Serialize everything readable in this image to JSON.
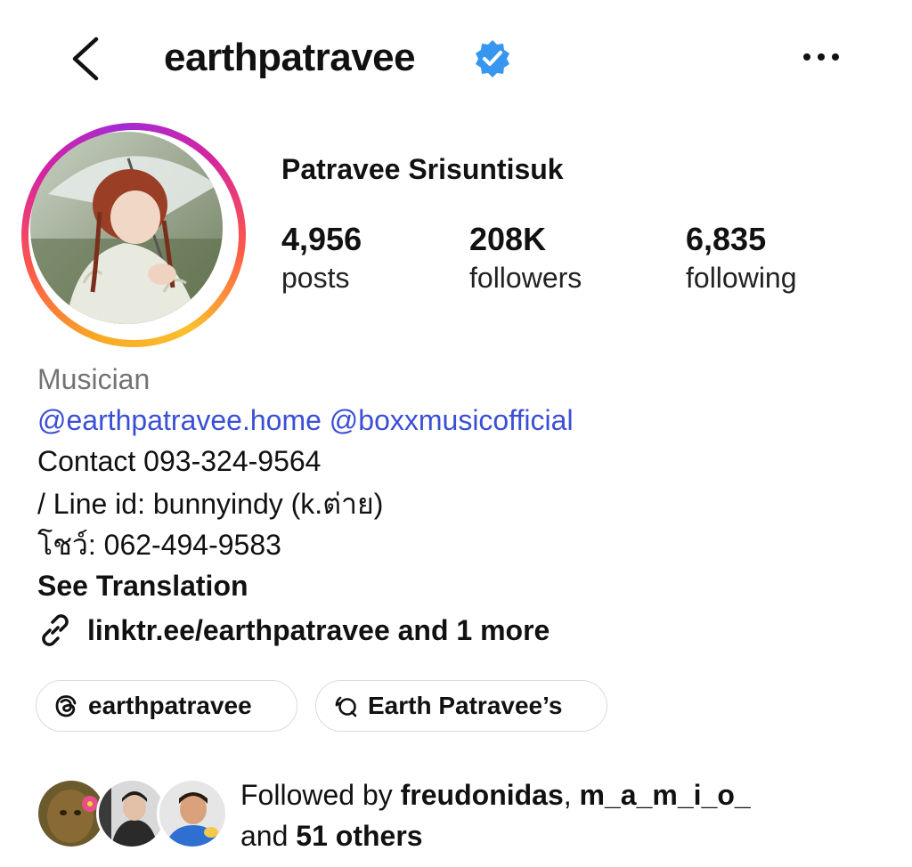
{
  "header": {
    "username": "earthpatravee",
    "back_icon": "chevron-left-icon",
    "verified_icon": "verified-badge-icon",
    "more_icon": "more-horizontal-icon"
  },
  "profile": {
    "full_name": "Patravee Srisuntisuk",
    "stats": {
      "posts": {
        "value": "4,956",
        "label": "posts"
      },
      "followers": {
        "value": "208K",
        "label": "followers"
      },
      "following": {
        "value": "6,835",
        "label": "following"
      }
    }
  },
  "bio": {
    "category": "Musician",
    "mentions": [
      "@earthpatravee.home",
      "@boxxmusicofficial"
    ],
    "lines": [
      "Contact 093-324-9564",
      "/ Line id: bunnyindy (k.ต่าย)",
      "โชว์: 062-494-9583"
    ],
    "see_translation": "See Translation",
    "link_text": "linktr.ee/earthpatravee and 1 more"
  },
  "pills": {
    "threads": "earthpatravee",
    "channel": "Earth Patravee’s"
  },
  "followed_by": {
    "prefix": "Followed by ",
    "user1": "freudonidas",
    "separator": ", ",
    "user2": "m_a_m_i_o_",
    "middle": "and ",
    "others": "51 others"
  },
  "colors": {
    "link_blue": "#3b4fd6",
    "verified_blue": "#3797f0",
    "muted_gray": "#737373",
    "pill_border": "#dbdbdb"
  }
}
